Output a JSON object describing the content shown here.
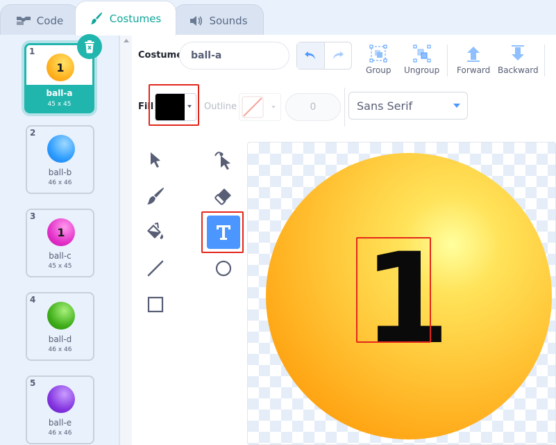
{
  "tabs": [
    {
      "label": "Code",
      "icon": "code-blocks-icon"
    },
    {
      "label": "Costumes",
      "icon": "paintbrush-icon",
      "active": true
    },
    {
      "label": "Sounds",
      "icon": "speaker-icon"
    }
  ],
  "costumes": [
    {
      "num": "1",
      "name": "ball-a",
      "size": "45 x 45",
      "color": "#ffb21f",
      "glyph": "1"
    },
    {
      "num": "2",
      "name": "ball-b",
      "size": "46 x 46",
      "color": "#2c9cff",
      "glyph": ""
    },
    {
      "num": "3",
      "name": "ball-c",
      "size": "45 x 45",
      "color": "#e331c9",
      "glyph": "1"
    },
    {
      "num": "4",
      "name": "ball-d",
      "size": "46 x 46",
      "color": "#3fae19",
      "glyph": ""
    },
    {
      "num": "5",
      "name": "ball-e",
      "size": "46 x 46",
      "color": "#8436e0",
      "glyph": ""
    }
  ],
  "editor": {
    "costume_label": "Costume",
    "costume_name": "ball-a",
    "group_label": "Group",
    "ungroup_label": "Ungroup",
    "forward_label": "Forward",
    "backward_label": "Backward",
    "fill_label": "Fill",
    "fill_color": "#000000",
    "outline_label": "Outline",
    "outline_width": "0",
    "font": "Sans Serif"
  },
  "canvas": {
    "text": "1",
    "ball_color": "#ffc83a"
  },
  "colors": {
    "accent": "#20b5ad",
    "blue": "#4c97ff",
    "highlight": "#e3261b"
  }
}
